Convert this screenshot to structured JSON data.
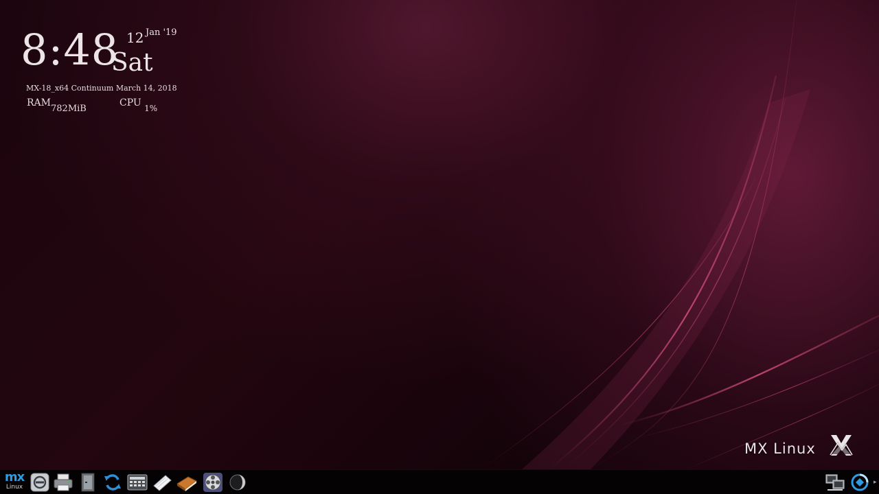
{
  "conky": {
    "time": "8:48",
    "day_of_month": "12",
    "month_year": "Jan '19",
    "weekday": "Sat",
    "system_line": "MX-18_x64 Continuum March 14, 2018",
    "ram_label": "RAM",
    "ram_value": "782MiB",
    "cpu_label": "CPU",
    "cpu_value": "1%"
  },
  "wallpaper": {
    "brand_text": "MX Linux",
    "accent_color": "#c2456e"
  },
  "taskbar": {
    "menu": {
      "mx_text": "mx",
      "linux_text": "Linux"
    },
    "launchers": [
      {
        "icon": "power-off-icon"
      },
      {
        "icon": "printer-icon"
      },
      {
        "icon": "file-manager-icon"
      },
      {
        "icon": "refresh-update-icon"
      },
      {
        "icon": "calculator-icon"
      },
      {
        "icon": "text-editor-icon"
      },
      {
        "icon": "book-manual-icon"
      },
      {
        "icon": "media-player-reel-icon"
      },
      {
        "icon": "moon-icon"
      }
    ],
    "tray": [
      {
        "icon": "network-wired-icon"
      },
      {
        "icon": "mx-updater-icon"
      }
    ],
    "colors": {
      "mx_blue": "#2f9be0",
      "bar_bg": "#050203"
    }
  }
}
